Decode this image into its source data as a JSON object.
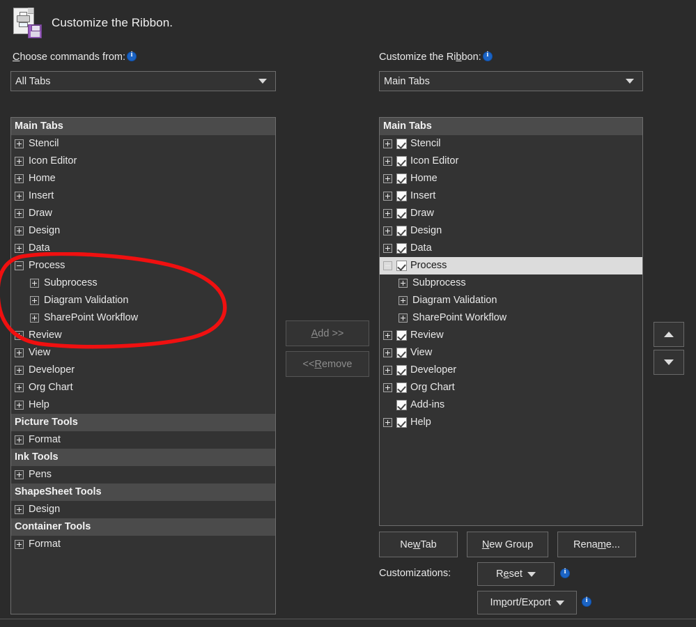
{
  "header": {
    "title": "Customize the Ribbon.",
    "icon": "print-save-icon"
  },
  "left_panel": {
    "label_prefix": "C",
    "label_rest": "hoose commands from:",
    "info_icon": "info-icon",
    "combo_value": "All Tabs",
    "groups": [
      {
        "header": "Main Tabs",
        "items": [
          {
            "label": "Stencil",
            "expander": "plus",
            "indent": 0
          },
          {
            "label": "Icon Editor",
            "expander": "plus",
            "indent": 0
          },
          {
            "label": "Home",
            "expander": "plus",
            "indent": 0
          },
          {
            "label": "Insert",
            "expander": "plus",
            "indent": 0
          },
          {
            "label": "Draw",
            "expander": "plus",
            "indent": 0
          },
          {
            "label": "Design",
            "expander": "plus",
            "indent": 0
          },
          {
            "label": "Data",
            "expander": "plus",
            "indent": 0
          },
          {
            "label": "Process",
            "expander": "minus",
            "indent": 0
          },
          {
            "label": "Subprocess",
            "expander": "plus",
            "indent": 1
          },
          {
            "label": "Diagram Validation",
            "expander": "plus",
            "indent": 1
          },
          {
            "label": "SharePoint Workflow",
            "expander": "plus",
            "indent": 1
          },
          {
            "label": "Review",
            "expander": "plus",
            "indent": 0
          },
          {
            "label": "View",
            "expander": "plus",
            "indent": 0
          },
          {
            "label": "Developer",
            "expander": "plus",
            "indent": 0
          },
          {
            "label": "Org Chart",
            "expander": "plus",
            "indent": 0
          },
          {
            "label": "Help",
            "expander": "plus",
            "indent": 0
          }
        ]
      },
      {
        "header": "Picture Tools",
        "items": [
          {
            "label": "Format",
            "expander": "plus",
            "indent": 0
          }
        ]
      },
      {
        "header": "Ink Tools",
        "items": [
          {
            "label": "Pens",
            "expander": "plus",
            "indent": 0
          }
        ]
      },
      {
        "header": "ShapeSheet Tools",
        "items": [
          {
            "label": "Design",
            "expander": "plus",
            "indent": 0
          }
        ]
      },
      {
        "header": "Container Tools",
        "items": [
          {
            "label": "Format",
            "expander": "plus",
            "indent": 0
          }
        ]
      }
    ]
  },
  "middle": {
    "add_label_prefix": "A",
    "add_label_rest": "dd >>",
    "add_enabled": false,
    "remove_label_prefix": "<< ",
    "remove_label_hot": "R",
    "remove_label_rest": "emove",
    "remove_enabled": false
  },
  "right_panel": {
    "label_prefix": "Customize the Ri",
    "label_hot": "b",
    "label_rest": "bon:",
    "info_icon": "info-icon",
    "combo_value": "Main Tabs",
    "group_header": "Main Tabs",
    "items": [
      {
        "label": "Stencil",
        "expander": "plus",
        "checkbox": true,
        "indent": 0,
        "selected": false
      },
      {
        "label": "Icon Editor",
        "expander": "plus",
        "checkbox": true,
        "indent": 0,
        "selected": false
      },
      {
        "label": "Home",
        "expander": "plus",
        "checkbox": true,
        "indent": 0,
        "selected": false
      },
      {
        "label": "Insert",
        "expander": "plus",
        "checkbox": true,
        "indent": 0,
        "selected": false
      },
      {
        "label": "Draw",
        "expander": "plus",
        "checkbox": true,
        "indent": 0,
        "selected": false
      },
      {
        "label": "Design",
        "expander": "plus",
        "checkbox": true,
        "indent": 0,
        "selected": false
      },
      {
        "label": "Data",
        "expander": "plus",
        "checkbox": true,
        "indent": 0,
        "selected": false
      },
      {
        "label": "Process",
        "expander": "minus",
        "checkbox": true,
        "indent": 0,
        "selected": true
      },
      {
        "label": "Subprocess",
        "expander": "plus",
        "checkbox": false,
        "indent": 1,
        "selected": false
      },
      {
        "label": "Diagram Validation",
        "expander": "plus",
        "checkbox": false,
        "indent": 1,
        "selected": false
      },
      {
        "label": "SharePoint Workflow",
        "expander": "plus",
        "checkbox": false,
        "indent": 1,
        "selected": false
      },
      {
        "label": "Review",
        "expander": "plus",
        "checkbox": true,
        "indent": 0,
        "selected": false
      },
      {
        "label": "View",
        "expander": "plus",
        "checkbox": true,
        "indent": 0,
        "selected": false
      },
      {
        "label": "Developer",
        "expander": "plus",
        "checkbox": true,
        "indent": 0,
        "selected": false
      },
      {
        "label": "Org Chart",
        "expander": "plus",
        "checkbox": true,
        "indent": 0,
        "selected": false
      },
      {
        "label": "Add-ins",
        "expander": "none",
        "checkbox": true,
        "indent": 0,
        "selected": false
      },
      {
        "label": "Help",
        "expander": "plus",
        "checkbox": true,
        "indent": 0,
        "selected": false
      }
    ],
    "buttons": {
      "new_tab_prefix": "Ne",
      "new_tab_hot": "w",
      "new_tab_rest": " Tab",
      "new_group_hot": "N",
      "new_group_rest": "ew Group",
      "rename_prefix": "Rena",
      "rename_hot": "m",
      "rename_rest": "e...",
      "move_up": "move-up-arrow",
      "move_down": "move-down-arrow"
    },
    "customizations_label": "Customizations:",
    "reset_prefix": "R",
    "reset_hot": "e",
    "reset_rest": "set",
    "import_export_prefix": "Im",
    "import_export_hot": "p",
    "import_export_rest": "ort/Export"
  },
  "annotation": {
    "shape": "red-oval",
    "color": "#f01010",
    "encircles": [
      "Process",
      "Subprocess",
      "Diagram Validation",
      "SharePoint Workflow"
    ]
  },
  "colors": {
    "background": "#2b2b2b",
    "panel": "#333333",
    "group_header": "#4b4b4b",
    "selection": "#dcdcdc",
    "border": "#6e6e6e",
    "text": "#e9e9e9",
    "accent_info": "#1c64c4",
    "annotation_red": "#f01010"
  }
}
